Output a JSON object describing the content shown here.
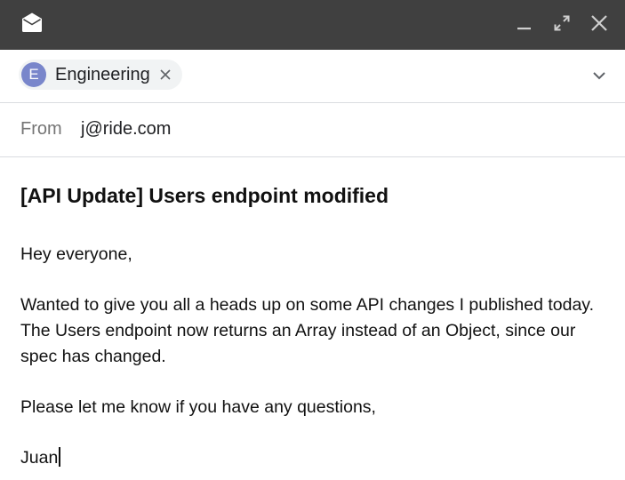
{
  "window": {
    "icon": "envelope-open-icon",
    "controls": [
      "minimize-icon",
      "expand-icon",
      "close-icon"
    ]
  },
  "recipients": {
    "chips": [
      {
        "initial": "E",
        "name": "Engineering",
        "avatar_color": "#7986cb"
      }
    ],
    "expand_icon": "chevron-down-icon"
  },
  "from": {
    "label": "From",
    "value": "j@ride.com"
  },
  "subject": "[API Update] Users endpoint modified",
  "body": {
    "greeting": "Hey everyone,",
    "paragraph_1_line_1": "Wanted to give you all a heads up on some API changes I published today.",
    "paragraph_1_line_2": "The Users endpoint now returns an Array instead of an Object, since our",
    "paragraph_1_line_3": "spec has changed.",
    "closing": "Please let me know if you have any questions,",
    "signature": "Juan"
  },
  "colors": {
    "titlebar": "#404040",
    "chip_background": "#f1f3f4",
    "divider": "#dadce0"
  }
}
